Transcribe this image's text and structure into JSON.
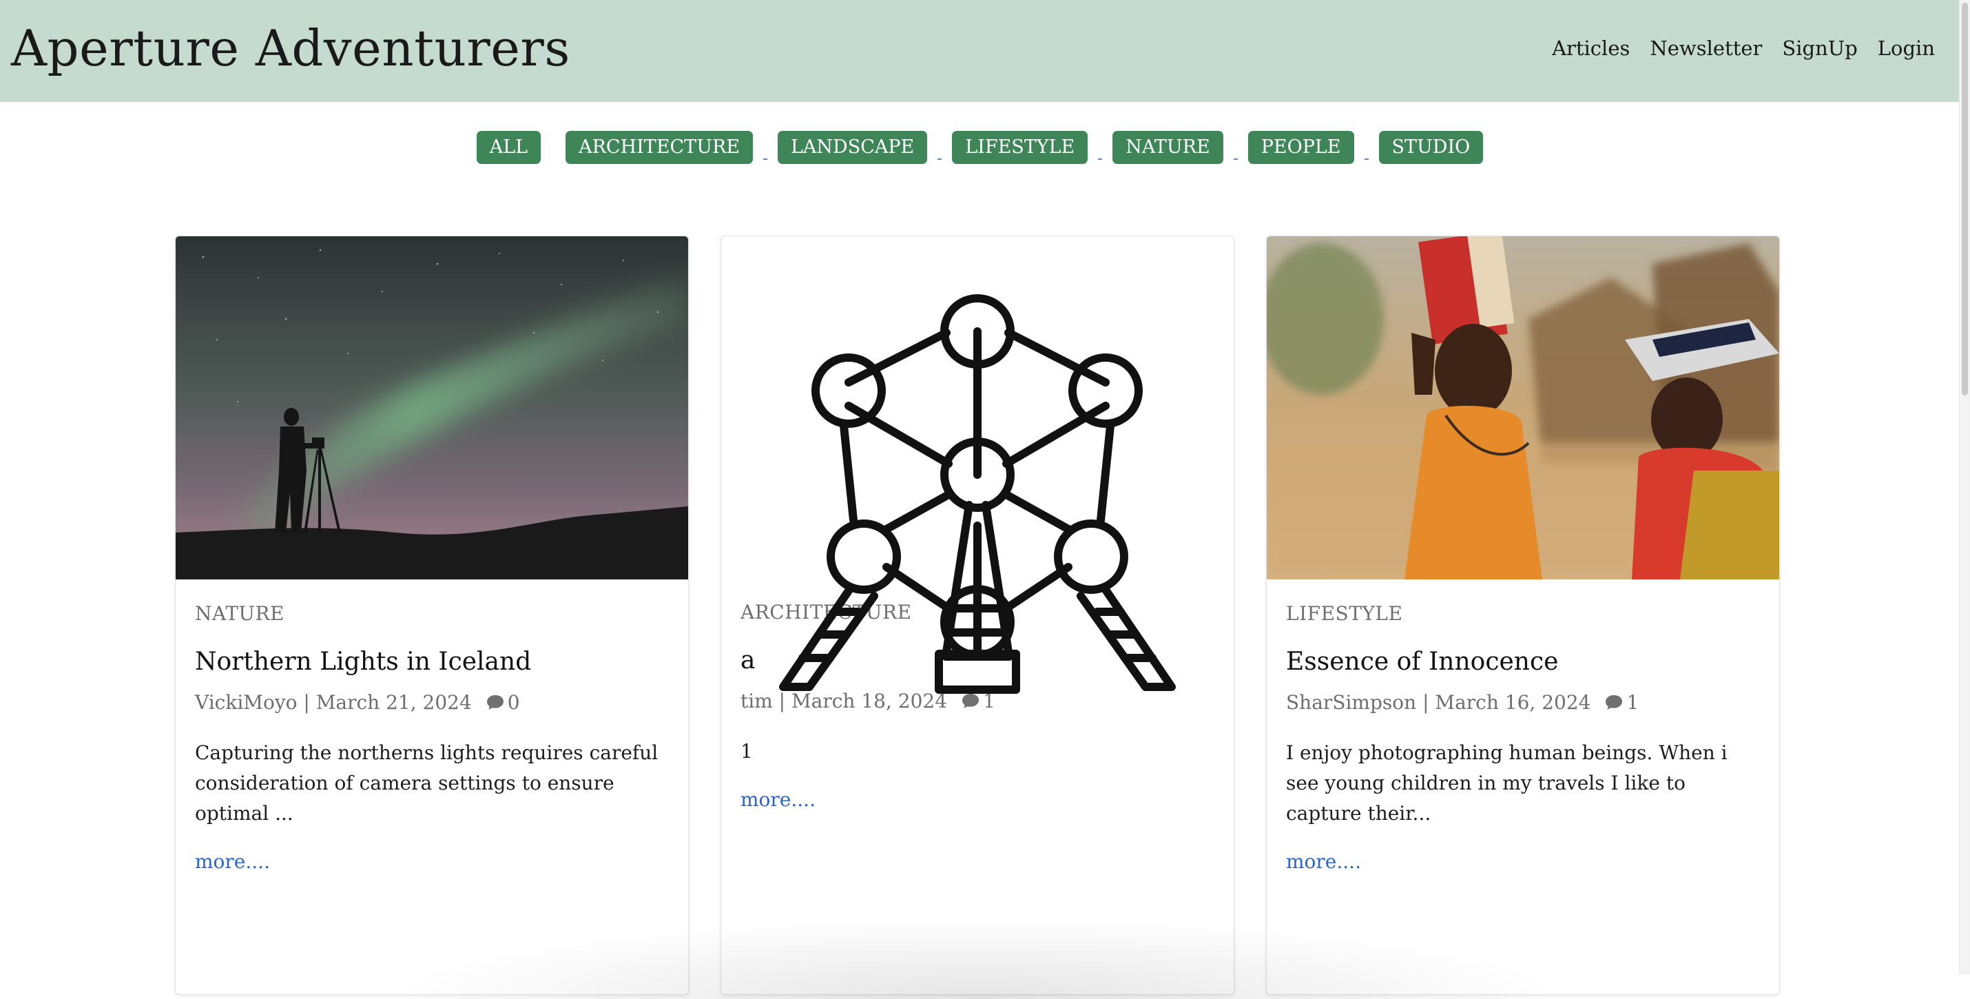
{
  "header": {
    "brand": "Aperture Adventurers",
    "nav": [
      "Articles",
      "Newsletter",
      "SignUp",
      "Login"
    ]
  },
  "filters": [
    "ALL",
    "ARCHITECTURE",
    "LANDSCAPE",
    "LIFESTYLE",
    "NATURE",
    "PEOPLE",
    "STUDIO"
  ],
  "colors": {
    "header_bg": "#c5dbcf",
    "pill_bg": "#3e8657",
    "link": "#2a66c9"
  },
  "cards": [
    {
      "category": "NATURE",
      "title": "Northern Lights in Iceland",
      "author": "VickiMoyo",
      "date": "March 21, 2024",
      "comments": "0",
      "excerpt": "Capturing the northerns lights requires careful consideration of camera settings to ensure optimal ...",
      "more": "more....",
      "image": "aurora-photographer-silhouette"
    },
    {
      "category": "ARCHITECTURE",
      "title": "a",
      "author": "tim",
      "date": "March 18, 2024",
      "comments": "1",
      "excerpt": "1",
      "more": "more....",
      "image": "atomium-icon"
    },
    {
      "category": "LIFESTYLE",
      "title": "Essence of Innocence",
      "author": "SharSimpson",
      "date": "March 16, 2024",
      "comments": "1",
      "excerpt": "I enjoy photographing human beings. When i see young children in my travels I like to capture their...",
      "more": "more....",
      "image": "children-village-photo"
    }
  ]
}
